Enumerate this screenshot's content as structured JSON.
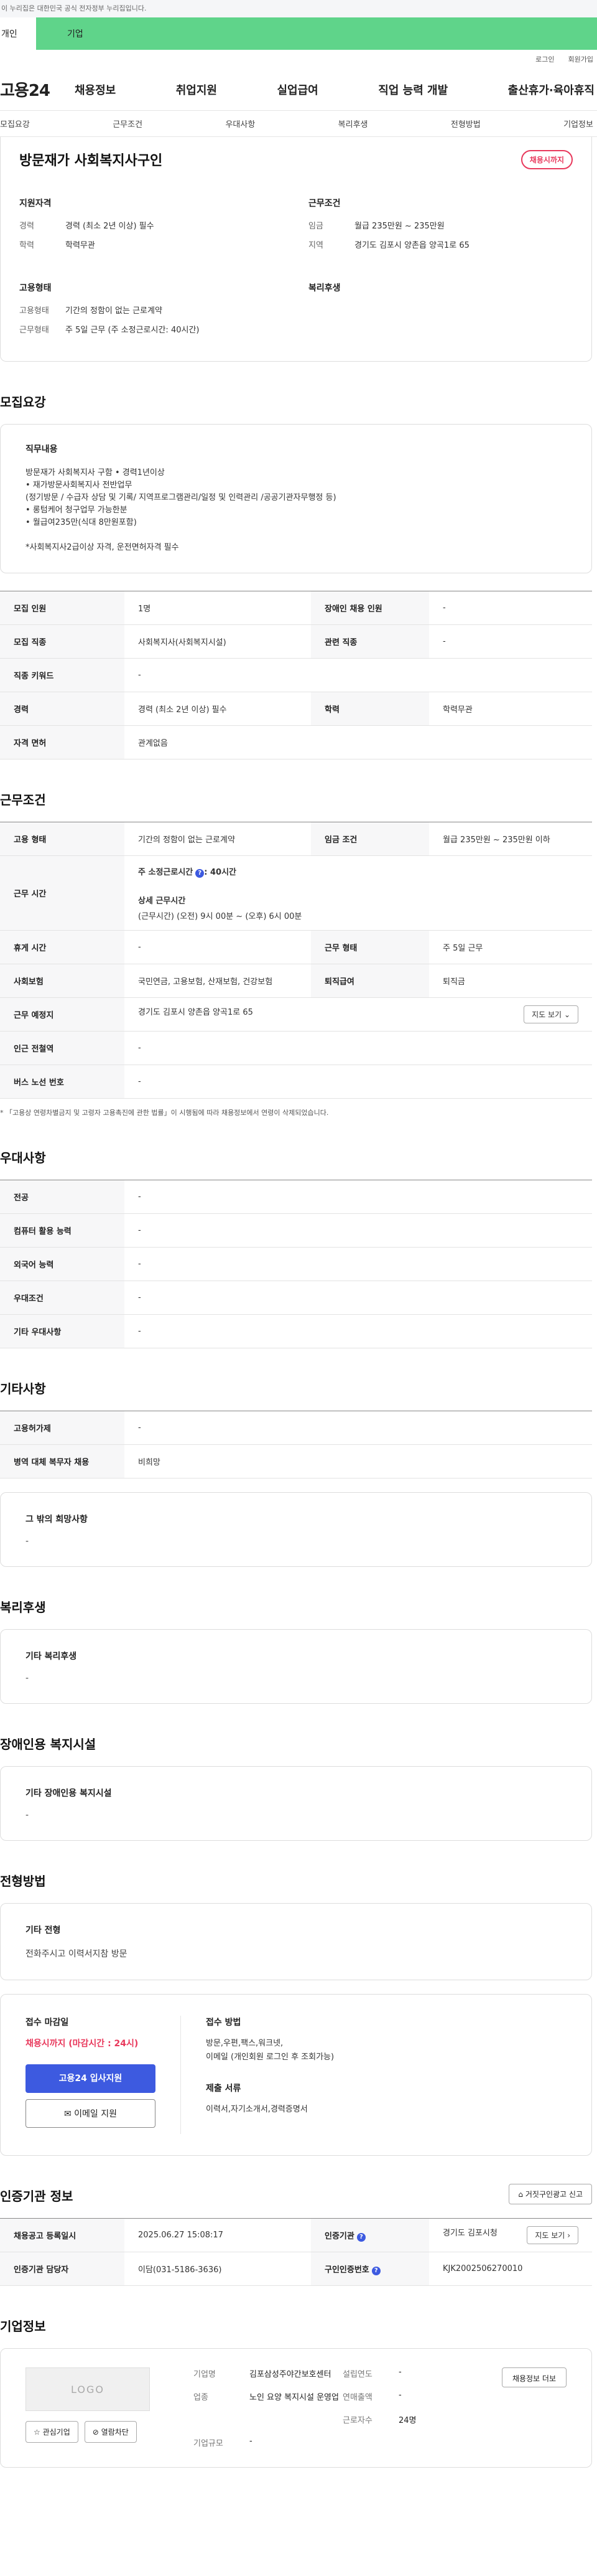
{
  "gov_banner": "이 누리집은 대한민국 공식 전자정부 누리집입니다.",
  "user_tabs": [
    {
      "label": "개인"
    },
    {
      "label": "기업"
    }
  ],
  "util_links": [
    "로그인",
    "회원가입"
  ],
  "logo": "고용24",
  "gnb": [
    "채용정보",
    "취업지원",
    "실업급여",
    "직업 능력 개발",
    "출산휴가·육아휴직"
  ],
  "anchor_tabs": [
    "모집요강",
    "근무조건",
    "우대사항",
    "복리후생",
    "전형방법",
    "기업정보"
  ],
  "title": "방문재가 사회복지사구인",
  "badge": "채용시까지",
  "summary": {
    "qual_title": "지원자격",
    "career_k": "경력",
    "career_v": "경력 (최소 2년 이상) 필수",
    "edu_k": "학력",
    "edu_v": "학력무관",
    "cond_title": "근무조건",
    "wage_k": "임금",
    "wage_v": "월급 235만원 ~ 235만원",
    "region_k": "지역",
    "region_v": "경기도 김포시 양촌읍 양곡1로 65",
    "emp_title": "고용형태",
    "emptype_k": "고용형태",
    "emptype_v": "기간의 정함이 없는 근로계약",
    "workform_k": "근무형태",
    "workform_v": "주 5일 근무 (주 소정근로시간: 40시간)",
    "welfare_title": "복리후생"
  },
  "recruit": {
    "heading": "모집요강",
    "duty_title": "직무내용",
    "duty_text": "방문재가 사회복지사 구함 • 경력1년이상\n• 재가방문사회복지사 전반업무\n(정기방문 / 수급자 상담 및 기록/ 지역프로그램관리/일정 및 인력관리 /공공기관자무행정 등)\n• 롱텀케어 청구업무 가능한분\n• 월급여235만(식대 8만원포함)\n\n*사회복지사2급이상 자격, 운전면허자격 필수",
    "rows": [
      [
        "모집 인원",
        "1명",
        "장애인 채용 인원",
        "-"
      ],
      [
        "모집 직종",
        "사회복지사(사회복지시설)",
        "관련 직종",
        "-"
      ],
      [
        "직종 키워드",
        "-"
      ],
      [
        "경력",
        "경력 (최소 2년 이상) 필수",
        "학력",
        "학력무관"
      ],
      [
        "자격 면허",
        "관계없음"
      ]
    ]
  },
  "cond": {
    "heading": "근무조건",
    "emp_k": "고용 형태",
    "emp_v": "기간의 정함이 없는 근로계약",
    "wage_k": "임금 조건",
    "wage_v": "월급 235만원 ~ 235만원 이하",
    "hours_k": "근무 시간",
    "hours_week": "주 소정근로시간",
    "hours_week_v": "40시간",
    "hours_detail_t": "상세 근무시간",
    "hours_detail_v": "(근무시간) (오전) 9시 00분 ~ (오후) 6시 00분",
    "rest_k": "휴게 시간",
    "rest_v": "-",
    "form_k": "근무 형태",
    "form_v": "주 5일 근무",
    "ins_k": "사회보험",
    "ins_v": "국민연금, 고용보험, 산재보험, 건강보험",
    "ret_k": "퇴직급여",
    "ret_v": "퇴직금",
    "place_k": "근무 예정지",
    "place_v": "경기도 김포시 양촌읍 양곡1로 65",
    "map_btn": "지도 보기",
    "subway_k": "인근 전철역",
    "subway_v": "-",
    "bus_k": "버스 노선 번호",
    "bus_v": "-",
    "note": "* 「고용상 연령차별금지 및 고령자 고용촉진에 관한 법률」이 시행됨에 따라 채용정보에서 연령이 삭제되었습니다."
  },
  "pref": {
    "heading": "우대사항",
    "rows": [
      [
        "전공",
        "-"
      ],
      [
        "컴퓨터 활용 능력",
        "-"
      ],
      [
        "외국어 능력",
        "-"
      ],
      [
        "우대조건",
        "-"
      ],
      [
        "기타 우대사항",
        "-"
      ]
    ]
  },
  "etc": {
    "heading": "기타사항",
    "rows": [
      [
        "고용허가제",
        "-"
      ],
      [
        "병역 대체 복무자 채용",
        "비희망"
      ]
    ],
    "other_title": "그 밖의 희망사항",
    "other_v": "-"
  },
  "welfare": {
    "heading": "복리후생",
    "title": "기타 복리후생",
    "v": "-"
  },
  "disabled": {
    "heading": "장애인용 복지시설",
    "title": "기타 장애인용 복지시설",
    "v": "-"
  },
  "select": {
    "heading": "전형방법",
    "title": "기타 전형",
    "v": "전화주시고 이력서지참 방문",
    "deadline_t": "접수 마감일",
    "deadline_v": "채용시까지 (마감시간 : 24시)",
    "apply_btn": "고용24 입사지원",
    "email_btn": "이메일 지원",
    "method_t": "접수 방법",
    "method_v": "방문,우편,팩스,워크넷,\n이메일 (개인회원 로그인 후 조회가능)",
    "docs_t": "제출 서류",
    "docs_v": "이력서,자기소개서,경력증명서"
  },
  "inst": {
    "heading": "인증기관 정보",
    "report_btn": "거짓구인광고 신고",
    "reg_k": "채용공고 등록일시",
    "reg_v": "2025.06.27 15:08:17",
    "org_k": "인증기관",
    "org_v": "경기도 김포시청",
    "map_btn": "지도 보기",
    "mgr_k": "인증기관 담당자",
    "mgr_v": "이담(031-5186-3636)",
    "no_k": "구인인증번호",
    "no_v": "KJK2002506270010"
  },
  "company": {
    "heading": "기업정보",
    "logo": "LOGO",
    "fav_btn": "관심기업",
    "follow_btn": "열람차단",
    "name_k": "기업명",
    "name_v": "김포삼성주야간보호센터",
    "year_k": "설립연도",
    "year_v": "-",
    "ind_k": "업종",
    "ind_v": "노인 요양 복지시설 운영업",
    "sales_k": "연매출액",
    "sales_v": "-",
    "emp_k": "근로자수",
    "emp_v": "24명",
    "size_k": "기업규모",
    "size_v": "-",
    "detail_btn": "채용정보 더보"
  }
}
